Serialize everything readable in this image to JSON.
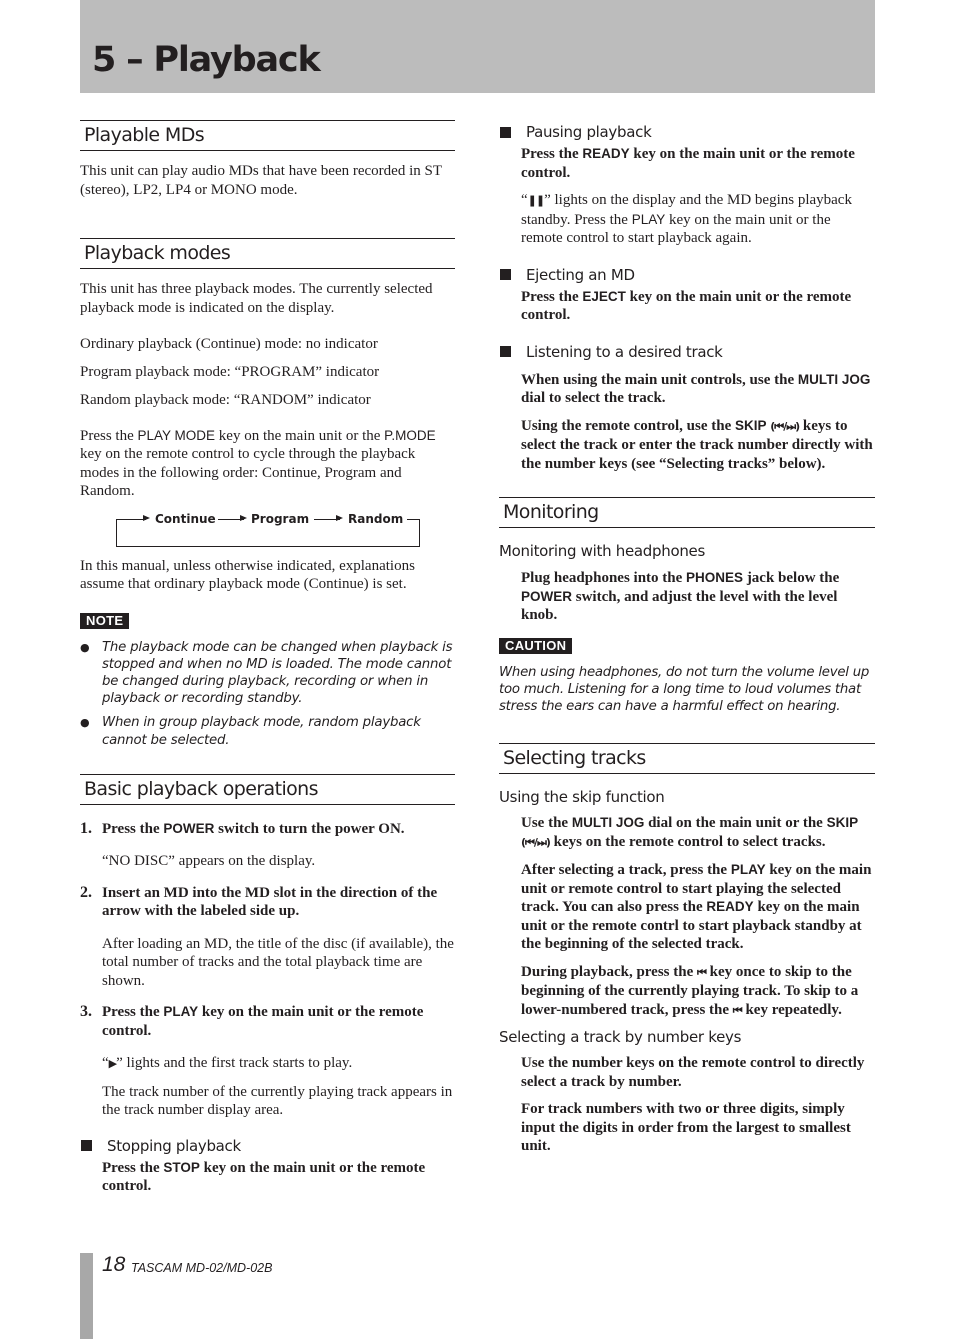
{
  "header": {
    "chapter_title": "5 – Playback"
  },
  "left": {
    "playable": {
      "heading": "Playable MDs",
      "body": "This unit can play audio MDs that have been recorded in ST (stereo), LP2, LP4 or MONO mode."
    },
    "modes": {
      "heading": "Playback modes",
      "intro": "This unit has three playback modes. The currently selected playback mode is indicated on the display.",
      "lines": [
        "Ordinary playback (Continue) mode: no indicator",
        "Program playback mode: “PROGRAM” indicator",
        "Random playback mode: “RANDOM” indicator"
      ],
      "press_pre": "Press the ",
      "key_play_mode": "PLAY MODE",
      "press_mid": " key on the main unit or the ",
      "key_pmode": "P.MODE",
      "press_post": " key on the remote control to cycle through the playback modes in the following order: Continue, Program and Random.",
      "flow": [
        "Continue",
        "Program",
        "Random"
      ],
      "manual_note": "In this manual, unless otherwise indicated, explanations assume that ordinary playback mode (Continue) is set.",
      "note_label": "NOTE",
      "notes": [
        "The playback mode can be changed when playback is stopped and when no MD is loaded. The mode cannot be changed during playback, recording or when in playback or recording standby.",
        "When in group playback mode, random playback cannot be selected."
      ]
    },
    "basic": {
      "heading": "Basic playback operations",
      "step1_num": "1.",
      "step1_pre": "Press the ",
      "step1_key": "POWER",
      "step1_post": " switch to turn the power ON.",
      "step1_result": "“NO DISC” appears on the display.",
      "step2_num": "2.",
      "step2": "Insert an MD into the MD slot in the direction of the arrow with the labeled side up.",
      "step2_result": "After loading an MD, the title of the disc (if available), the total number of tracks and the total playback time are shown.",
      "step3_num": "3.",
      "step3_pre": "Press the ",
      "step3_key": "PLAY",
      "step3_post": " key on the main unit or the remote control.",
      "step3_result_pre": "“",
      "step3_result_glyph": "▶",
      "step3_result_post": "” lights and the first track starts to play.",
      "step3_result2": "The track number of the currently playing track appears in the track number display area.",
      "stopping_heading": "Stopping playback",
      "stopping_pre": "Press the ",
      "stopping_key": "STOP",
      "stopping_post": " key on the main unit or the remote control."
    }
  },
  "right": {
    "pausing": {
      "heading": "Pausing playback",
      "instr_pre": "Press the ",
      "instr_key": "READY",
      "instr_post": " key on the main unit or the remote control.",
      "body_pre": "“",
      "body_glyph": "❚❚",
      "body_mid": "” lights on the display and the MD begins playback standby. Press the ",
      "body_key": "PLAY",
      "body_post": " key on the main unit or the remote control to start playback again."
    },
    "ejecting": {
      "heading": "Ejecting an MD",
      "instr_pre": "Press the ",
      "instr_key": "EJECT",
      "instr_post": " key on the main unit or the remote control."
    },
    "listening": {
      "heading": "Listening to a desired track",
      "p1_pre": "When using the main unit controls, use the ",
      "p1_key": "MULTI JOG",
      "p1_post": " dial to select the track.",
      "p2_pre": "Using the remote control, use the ",
      "p2_key": "SKIP",
      "p2_glyph": "(⏮/⏭)",
      "p2_post": " keys to select the track or enter the track number directly with the number keys (see “Selecting tracks” below)."
    },
    "monitoring": {
      "heading": "Monitoring",
      "sub": "Monitoring with headphones",
      "p_pre": "Plug headphones into the ",
      "p_key1": "PHONES",
      "p_mid": " jack below the ",
      "p_key2": "POWER",
      "p_post": " switch, and adjust the level with the level knob.",
      "caution_label": "CAUTION",
      "caution": "When using headphones, do not turn the volume level up too much. Listening for a long time to loud volumes that stress the ears can have a harmful effect on hearing."
    },
    "selecting": {
      "heading": "Selecting tracks",
      "sub1": "Using the skip function",
      "p1_pre": "Use the ",
      "p1_key1": "MULTI JOG",
      "p1_mid": " dial on the main unit or the ",
      "p1_key2": "SKIP",
      "p1_glyph": "(⏮/⏭)",
      "p1_post": " keys on the remote control to select tracks.",
      "p2_pre": "After selecting a track, press the ",
      "p2_key1": "PLAY",
      "p2_mid": " key on the main unit or remote control to start playing the selected track. You can also press the ",
      "p2_key2": "READY",
      "p2_post": " key on the main unit or the remote contrl to start playback standby at the beginning of the selected track.",
      "p3_pre": "During playback, press the ",
      "p3_glyph": "⏮",
      "p3_mid": " key once to skip to the beginning of the currently playing track. To skip to a lower-numbered track, press the ",
      "p3_glyph2": "⏮",
      "p3_post": " key repeatedly.",
      "sub2": "Selecting a track by number keys",
      "p4": "Use the number keys on the remote control to directly select a track by number.",
      "p5": "For track numbers with two or three digits, simply input the digits in order from the largest to smallest unit."
    }
  },
  "footer": {
    "page_number": "18",
    "model": "TASCAM  MD-02/MD-02B"
  }
}
